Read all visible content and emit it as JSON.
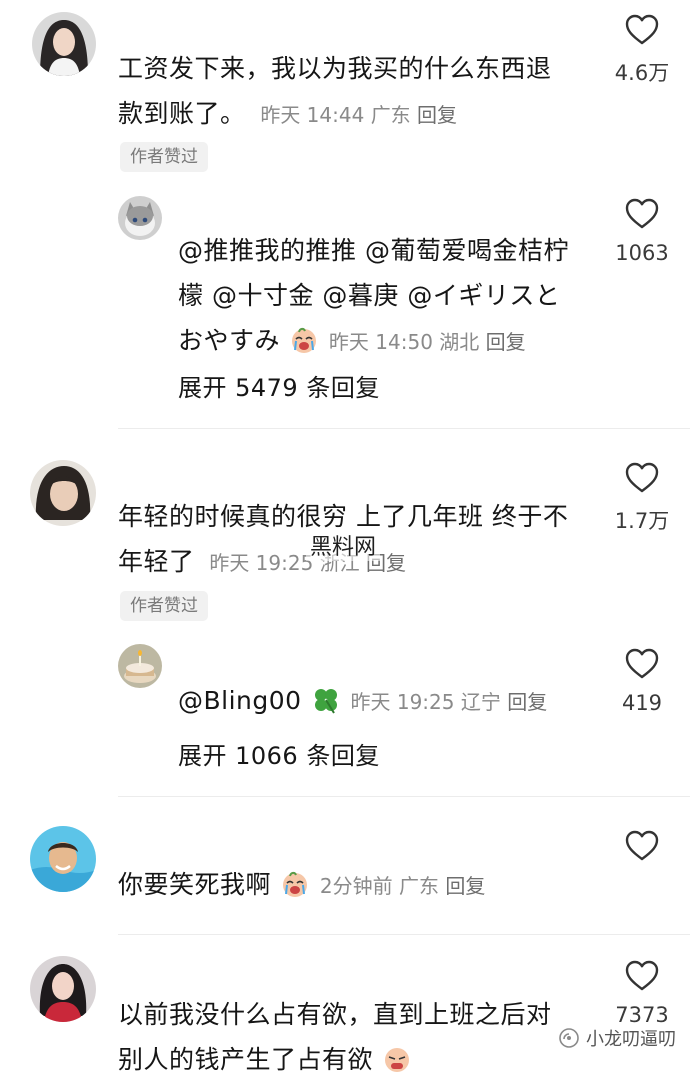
{
  "comments": [
    {
      "text_line1": "工资发下来，我以为我买的什么东西退",
      "text_line2": "款到账了。",
      "time": "昨天 14:44",
      "location": "广东",
      "reply": "回复",
      "likes": "4.6万",
      "badge": "作者赞过",
      "avatar": "avatar-woman-dark-hair"
    },
    {
      "text_line1": "@推推我的推推 @葡萄爱喝金桔柠",
      "text_line2": "檬 @十寸金 @暮庚 @イギリスと",
      "text_line3": "おやすみ",
      "time": "昨天 14:50",
      "location": "湖北",
      "reply": "回复",
      "likes": "1063",
      "expand": "展开 5479 条回复",
      "avatar": "avatar-cat"
    },
    {
      "text_line1": "年轻的时候真的很穷 上了几年班 终于不",
      "text_line2": "年轻了",
      "time": "昨天 19:25",
      "location": "浙江",
      "reply": "回复",
      "likes": "1.7万",
      "badge": "作者赞过",
      "avatar": "avatar-man-long-hair"
    },
    {
      "text_line1": "@Bling00",
      "time": "昨天 19:25",
      "location": "辽宁",
      "reply": "回复",
      "likes": "419",
      "expand": "展开 1066 条回复",
      "avatar": "avatar-cake"
    },
    {
      "text_line1": "你要笑死我啊",
      "time": "2分钟前",
      "location": "广东",
      "reply": "回复",
      "avatar": "avatar-boy-pool"
    },
    {
      "text_line1": "以前我没什么占有欲，直到上班之后对",
      "text_line2": "别人的钱产生了占有欲",
      "likes": "7373",
      "avatar": "avatar-woman-red"
    }
  ],
  "watermark": "黑料网",
  "brand": "小龙叨逼叨",
  "colors": {
    "text": "#161616",
    "meta": "#8a8a8a",
    "badge_bg": "#f1f1f1"
  }
}
